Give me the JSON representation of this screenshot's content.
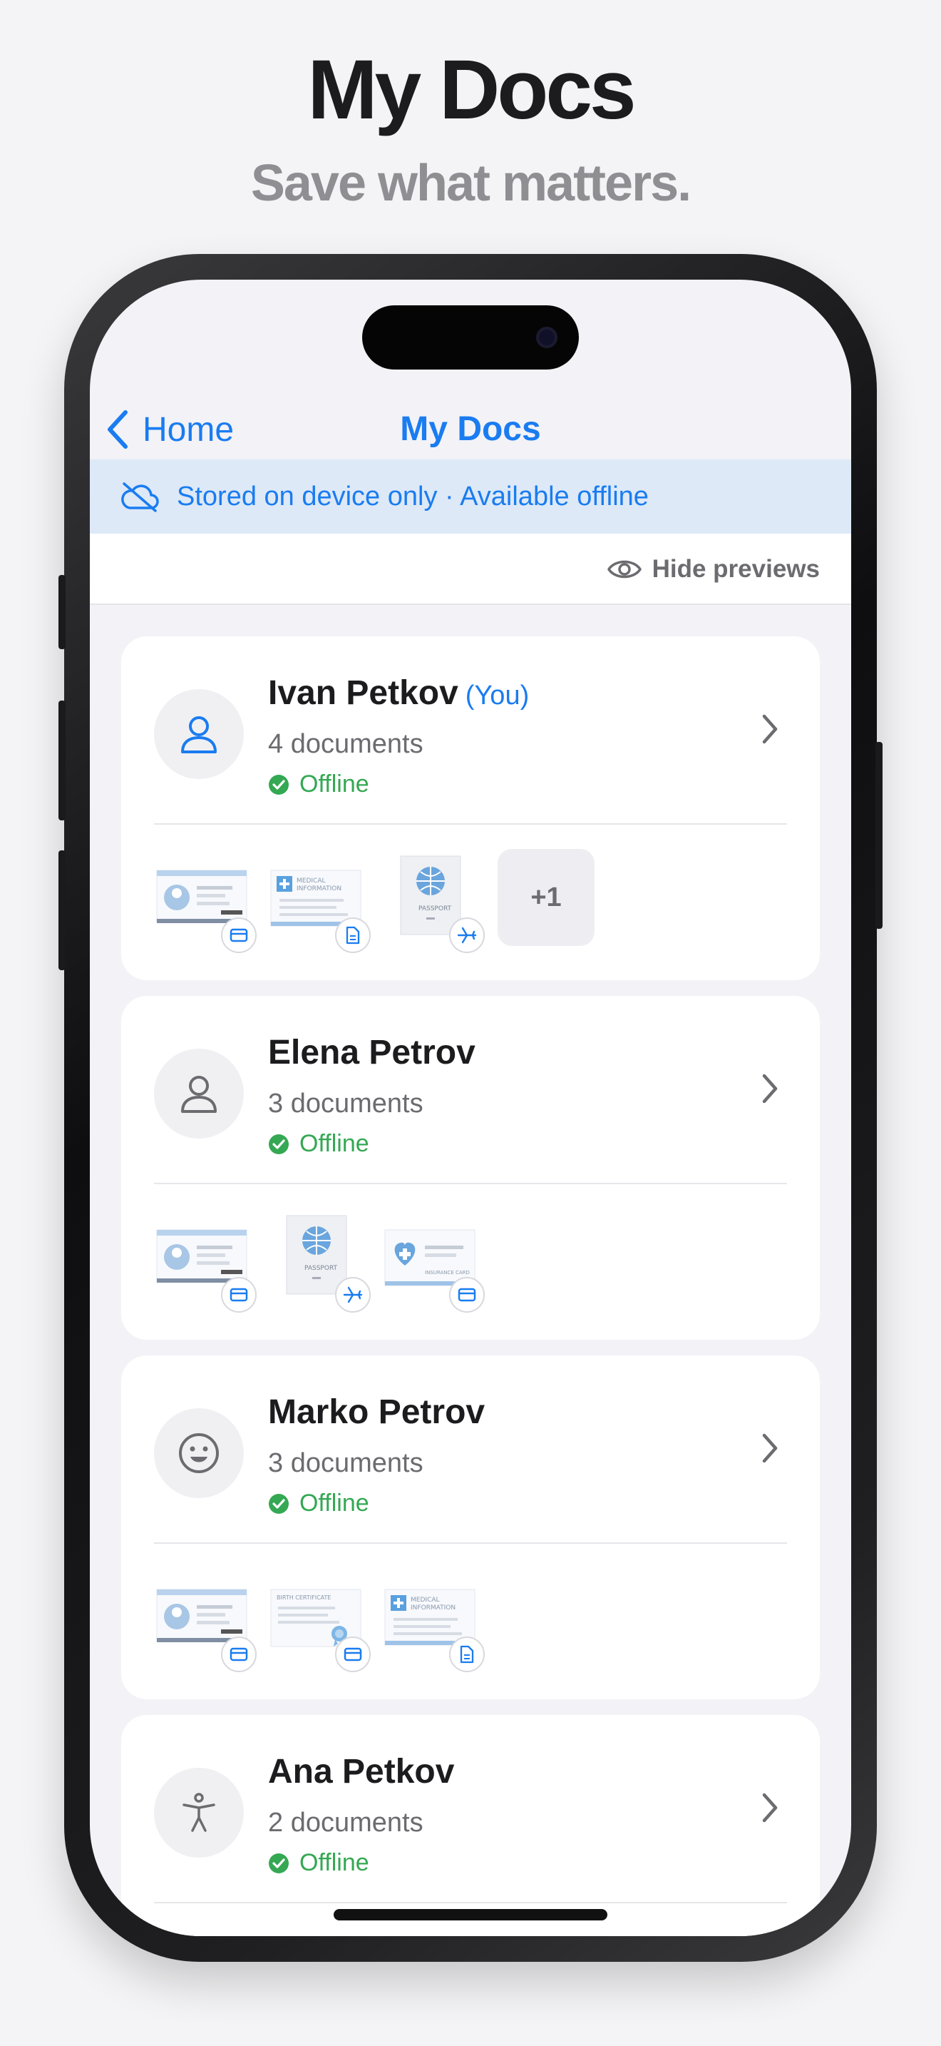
{
  "promo": {
    "title": "My Docs",
    "subtitle": "Save what matters."
  },
  "nav": {
    "back_label": "Home",
    "title": "My Docs"
  },
  "banner": {
    "text": "Stored on device only · Available offline",
    "icon": "cloud-off-icon"
  },
  "toolbar": {
    "hide_previews_label": "Hide previews",
    "icon": "eye-icon"
  },
  "colors": {
    "accent": "#1a7cf0",
    "offline_green": "#34a853",
    "banner_bg": "#dde9f7"
  },
  "people": [
    {
      "name": "Ivan Petkov",
      "you_label": "(You)",
      "count": "4 documents",
      "status": "Offline",
      "avatar_icon": "person-icon",
      "docs": [
        {
          "type": "id-card",
          "badge_icon": "card-icon"
        },
        {
          "type": "medical",
          "label": "MEDICAL INFORMATION",
          "badge_icon": "document-icon"
        },
        {
          "type": "passport",
          "label": "PASSPORT",
          "badge_icon": "plane-icon"
        }
      ],
      "more": "+1"
    },
    {
      "name": "Elena Petrov",
      "count": "3 documents",
      "status": "Offline",
      "avatar_icon": "person-icon",
      "docs": [
        {
          "type": "id-card",
          "badge_icon": "card-icon"
        },
        {
          "type": "passport",
          "label": "PASSPORT",
          "badge_icon": "plane-icon"
        },
        {
          "type": "insurance",
          "label": "INSURANCE CARD",
          "badge_icon": "card-icon"
        }
      ]
    },
    {
      "name": "Marko Petrov",
      "count": "3 documents",
      "status": "Offline",
      "avatar_icon": "smiley-icon",
      "docs": [
        {
          "type": "id-card",
          "badge_icon": "card-icon"
        },
        {
          "type": "birth",
          "label": "BIRTH CERTIFICATE",
          "badge_icon": "card-icon"
        },
        {
          "type": "medical",
          "label": "MEDICAL INFORMATION",
          "badge_icon": "document-icon"
        }
      ]
    },
    {
      "name": "Ana Petkov",
      "count": "2 documents",
      "status": "Offline",
      "avatar_icon": "accessibility-icon",
      "docs": []
    }
  ]
}
